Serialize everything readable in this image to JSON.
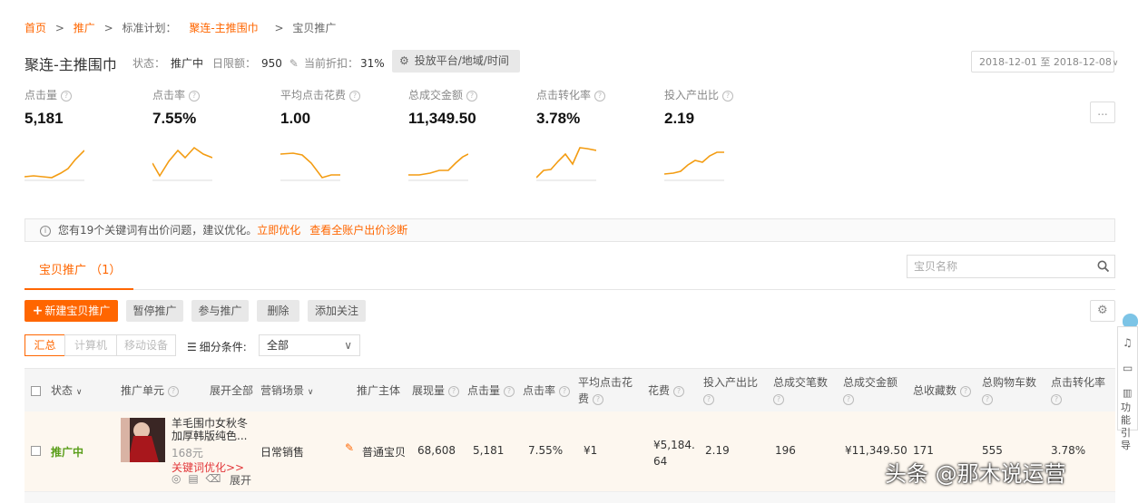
{
  "breadcrumb": {
    "home": "首页",
    "promotion": "推广",
    "plan_label": "标准计划：",
    "plan_name": "聚连-主推围巾",
    "current": "宝贝推广",
    "sep": ">"
  },
  "plan": {
    "title": "聚连-主推围巾",
    "status_label": "状态：",
    "status_value": "推广中",
    "budget_label": "日限额：",
    "budget_value": "950",
    "discount_label": "当前折扣：",
    "discount_value": "31%",
    "platform_button": "投放平台/地域/时间",
    "date_range": "2018-12-01 至 2018-12-08"
  },
  "kpis": [
    {
      "label": "点击量",
      "value": "5,181"
    },
    {
      "label": "点击率",
      "value": "7.55%"
    },
    {
      "label": "平均点击花费",
      "value": "1.00"
    },
    {
      "label": "总成交金额",
      "value": "11,349.50"
    },
    {
      "label": "点击转化率",
      "value": "3.78%"
    },
    {
      "label": "投入产出比",
      "value": "2.19"
    }
  ],
  "more_button": "...",
  "notice": {
    "text": "您有19个关键词有出价问题，建议优化。",
    "link1": "立即优化",
    "link2": "查看全账户出价诊断"
  },
  "tab": {
    "label": "宝贝推广 （1）"
  },
  "search": {
    "placeholder": "宝贝名称"
  },
  "actions": {
    "new": "新建宝贝推广",
    "pause": "暂停推广",
    "join": "参与推广",
    "delete": "删除",
    "follow": "添加关注"
  },
  "segments": {
    "summary": "汇总",
    "computer": "计算机",
    "mobile": "移动设备"
  },
  "filter": {
    "label": "细分条件:",
    "value": "全部"
  },
  "table": {
    "headers": {
      "status": "状态",
      "unit": "推广单元",
      "expand_all": "展开全部",
      "scene": "营销场景",
      "subject": "推广主体",
      "impressions": "展现量",
      "clicks": "点击量",
      "ctr": "点击率",
      "avg_cpc_1": "平均点击花",
      "avg_cpc_2": "费",
      "cost": "花费",
      "roi": "投入产出比",
      "orders": "总成交笔数",
      "gmv": "总成交金额",
      "favorites": "总收藏数",
      "cart": "总购物车数",
      "cvr": "点击转化率"
    },
    "row": {
      "status": "推广中",
      "title_1": "羊毛围巾女秋冬",
      "title_2": "加厚韩版纯色...",
      "price": "168元",
      "kw_opt": "关键词优化>>",
      "expand": "展开",
      "scene": "日常销售",
      "subject": "普通宝贝",
      "impressions": "68,608",
      "clicks": "5,181",
      "ctr": "7.55%",
      "avg_cpc": "¥1",
      "cost_1": "¥5,184.",
      "cost_2": "64",
      "roi": "2.19",
      "orders": "196",
      "gmv": "¥11,349.50",
      "favorites": "171",
      "cart": "555",
      "cvr": "3.78%"
    }
  },
  "side_tools": {
    "guide_1": "功能",
    "guide_2": "引导"
  },
  "watermark": "头条 @那木说运营",
  "colors": {
    "accent": "#ff6600",
    "status_green": "#5a9e1a"
  }
}
